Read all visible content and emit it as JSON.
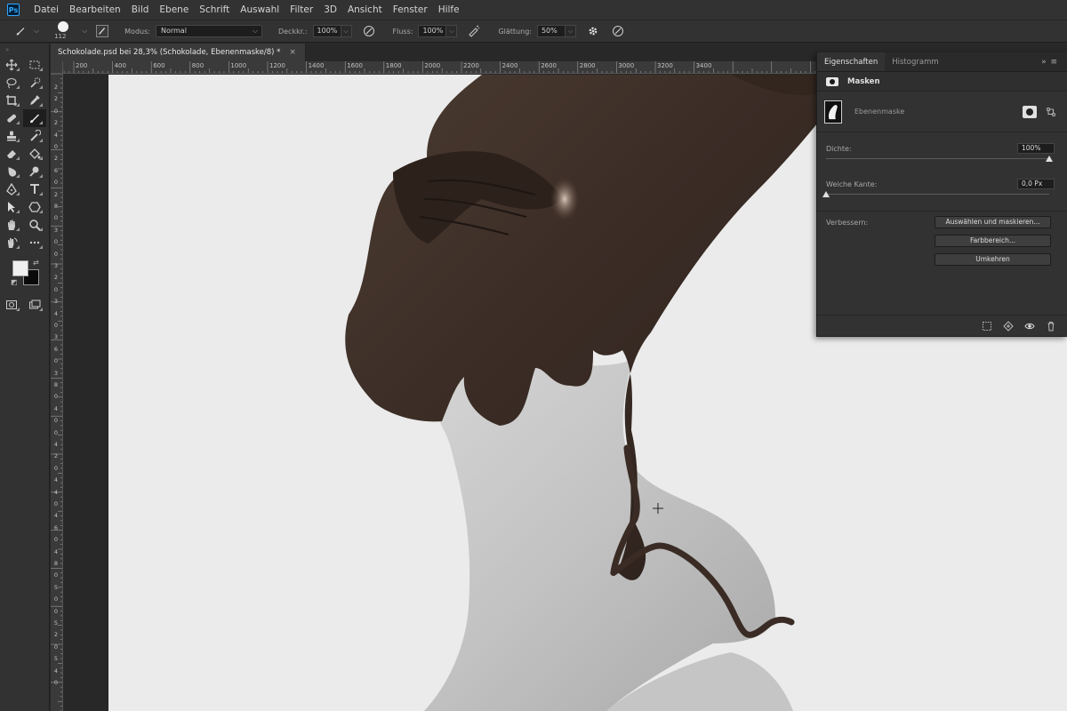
{
  "app": {
    "logo": "Ps",
    "menu": [
      "Datei",
      "Bearbeiten",
      "Bild",
      "Ebene",
      "Schrift",
      "Auswahl",
      "Filter",
      "3D",
      "Ansicht",
      "Fenster",
      "Hilfe"
    ]
  },
  "options": {
    "brush_size": "112",
    "mode_label": "Modus:",
    "mode_value": "Normal",
    "opacity_label": "Deckkr.:",
    "opacity_value": "100%",
    "flow_label": "Fluss:",
    "flow_value": "100%",
    "smoothing_label": "Glättung:",
    "smoothing_value": "50%"
  },
  "document": {
    "tab_title": "Schokolade.psd bei 28,3% (Schokolade, Ebenenmaske/8) *",
    "close_glyph": "×",
    "ruler_top": [
      "200",
      "400",
      "600",
      "800",
      "1000",
      "1200",
      "1400",
      "1600",
      "1800",
      "2000",
      "2200",
      "2400",
      "2600",
      "2800",
      "3000",
      "3200",
      "3400"
    ],
    "ruler_left": [
      "2",
      "2",
      "0",
      "2",
      "4",
      "0",
      "2",
      "6",
      "0",
      "2",
      "8",
      "0",
      "3",
      "0",
      "0",
      "3",
      "2",
      "0",
      "3",
      "4",
      "0",
      "3",
      "6",
      "0",
      "3",
      "8",
      "0",
      "4",
      "0",
      "0",
      "4",
      "2",
      "0",
      "4",
      "4",
      "0",
      "4",
      "6",
      "0",
      "4",
      "8",
      "0",
      "5",
      "0",
      "0",
      "5",
      "2",
      "0",
      "5",
      "4",
      "0"
    ]
  },
  "panel": {
    "tabs": [
      "Eigenschaften",
      "Histogramm"
    ],
    "menu_glyph": "»  ≡",
    "section_title": "Masken",
    "mask_label": "Ebenenmaske",
    "density_label": "Dichte:",
    "density_value": "100%",
    "density_level": 1.0,
    "feather_label": "Weiche Kante:",
    "feather_value": "0,0 Px",
    "feather_level": 0.0,
    "improve_label": "Verbessern:",
    "btn_select_mask": "Auswählen und maskieren...",
    "btn_color_range": "Farbbereich...",
    "btn_invert": "Umkehren"
  },
  "colors": {
    "foreground": "#f0f0f0",
    "background": "#0a0a0a",
    "canvas": "#ebebeb",
    "chocolate": "#3a2c25"
  }
}
